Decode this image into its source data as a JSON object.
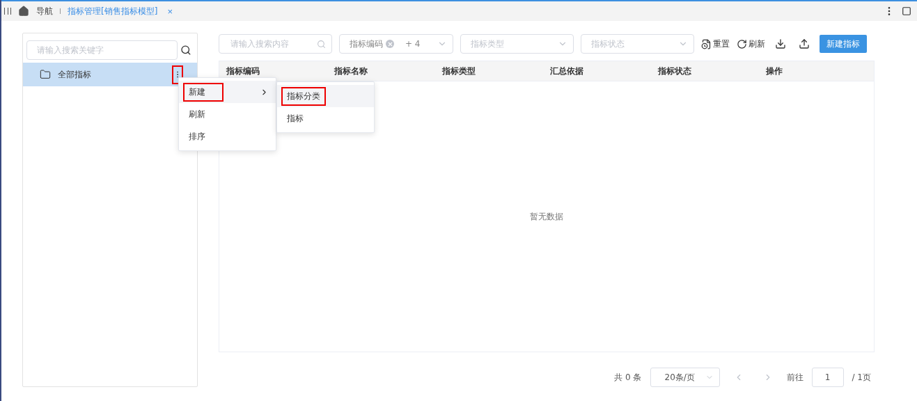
{
  "top_bar": {
    "nav_label": "导航",
    "tab": {
      "label": "指标管理[销售指标模型]",
      "close": "×",
      "selected": true
    }
  },
  "sidebar": {
    "search": {
      "placeholder": "请输入搜索关键字"
    },
    "tree": [
      {
        "label": "全部指标",
        "selected": true,
        "highlighted": true
      }
    ],
    "context_menu": [
      {
        "label": "新建",
        "has_submenu": true,
        "hovered": true,
        "highlighted": true
      },
      {
        "label": "刷新",
        "has_submenu": false,
        "hovered": false,
        "highlighted": false
      },
      {
        "label": "排序",
        "has_submenu": false,
        "hovered": false,
        "highlighted": false
      }
    ],
    "submenu": [
      {
        "label": "指标分类",
        "hovered": true,
        "highlighted": true
      },
      {
        "label": "指标",
        "hovered": false,
        "highlighted": false
      }
    ]
  },
  "toolbar": {
    "search": {
      "placeholder": "请输入搜索内容"
    },
    "code_select": {
      "tag": "指标编码",
      "more": "+ 4"
    },
    "type_select": {
      "placeholder": "指标类型"
    },
    "status_select": {
      "placeholder": "指标状态"
    },
    "reset": "重置",
    "refresh": "刷新",
    "create": "新建指标"
  },
  "table": {
    "columns": [
      "指标编码",
      "指标名称",
      "指标类型",
      "汇总依据",
      "指标状态",
      "操作"
    ],
    "empty": "暂无数据"
  },
  "pagination": {
    "total": "共 0 条",
    "page_size": "20条/页",
    "goto": "前往",
    "page": "1",
    "pages": "/ 1页"
  }
}
